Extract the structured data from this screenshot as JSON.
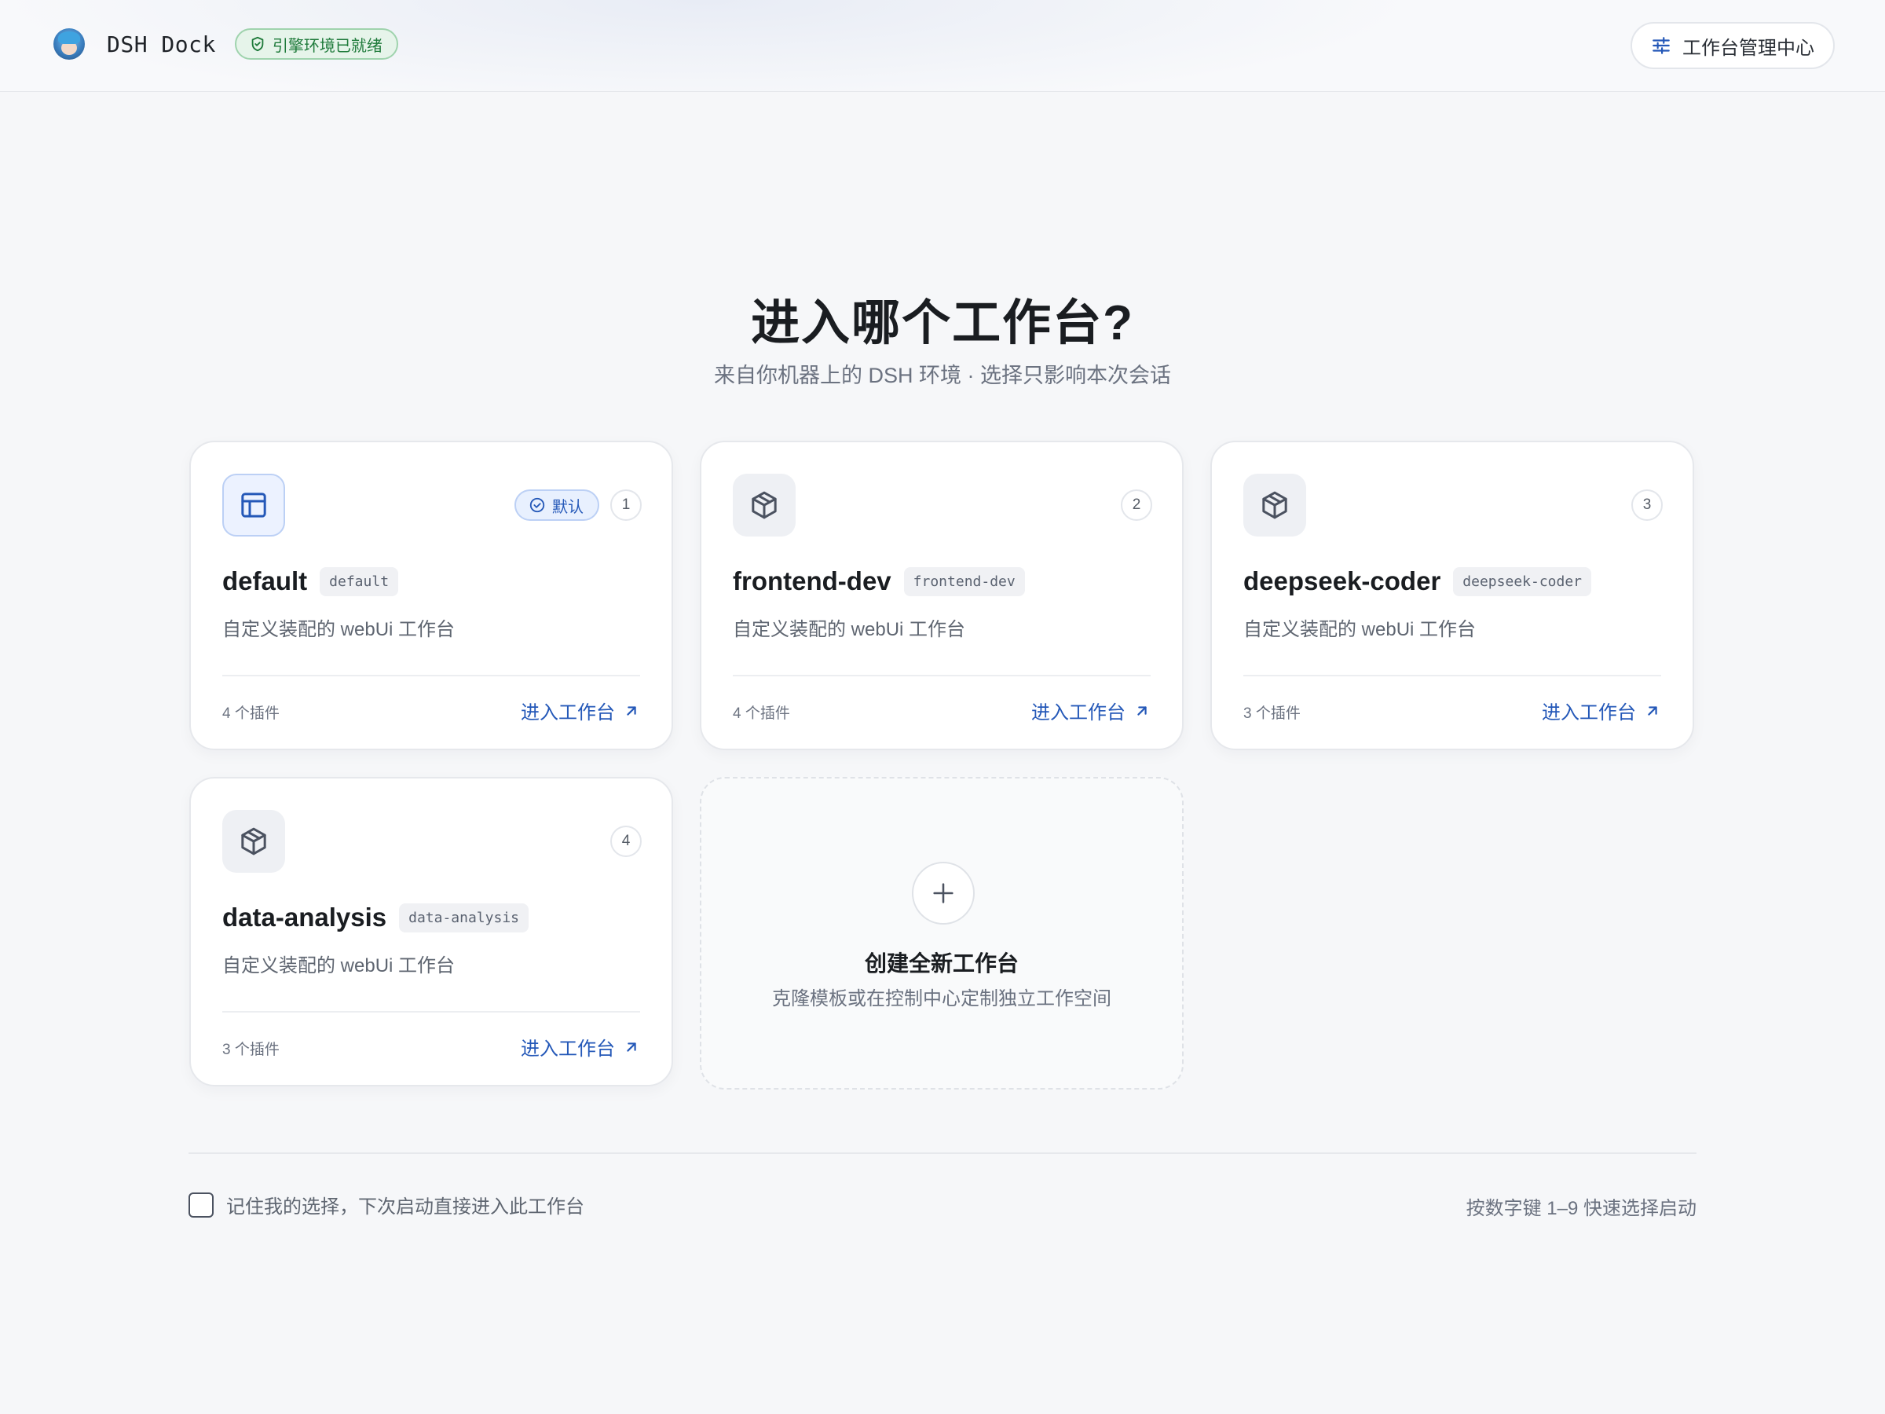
{
  "header": {
    "app_name": "DSH Dock",
    "env_status": "引擎环境已就绪",
    "manager_button": "工作台管理中心"
  },
  "main": {
    "title": "进入哪个工作台?",
    "subtitle": "来自你机器上的 DSH 环境 · 选择只影响本次会话"
  },
  "workspaces": [
    {
      "name": "default",
      "slug": "default",
      "description": "自定义装配的 webUi 工作台",
      "plugins": "4 个插件",
      "enter_label": "进入工作台",
      "shortcut": "1",
      "default_badge": "默认",
      "icon": "layout-icon"
    },
    {
      "name": "frontend-dev",
      "slug": "frontend-dev",
      "description": "自定义装配的 webUi 工作台",
      "plugins": "4 个插件",
      "enter_label": "进入工作台",
      "shortcut": "2",
      "icon": "package-icon"
    },
    {
      "name": "deepseek-coder",
      "slug": "deepseek-coder",
      "description": "自定义装配的 webUi 工作台",
      "plugins": "3 个插件",
      "enter_label": "进入工作台",
      "shortcut": "3",
      "icon": "package-icon"
    },
    {
      "name": "data-analysis",
      "slug": "data-analysis",
      "description": "自定义装配的 webUi 工作台",
      "plugins": "3 个插件",
      "enter_label": "进入工作台",
      "shortcut": "4",
      "icon": "package-icon"
    }
  ],
  "create": {
    "title": "创建全新工作台",
    "description": "克隆模板或在控制中心定制独立工作空间"
  },
  "footer": {
    "remember_label": "记住我的选择，下次启动直接进入此工作台",
    "remember_checked": false,
    "shortcut_hint": "按数字键 1–9 快速选择启动"
  },
  "colors": {
    "accent": "#2458b8",
    "success": "#1e7a3a",
    "background": "#f6f7f9"
  }
}
